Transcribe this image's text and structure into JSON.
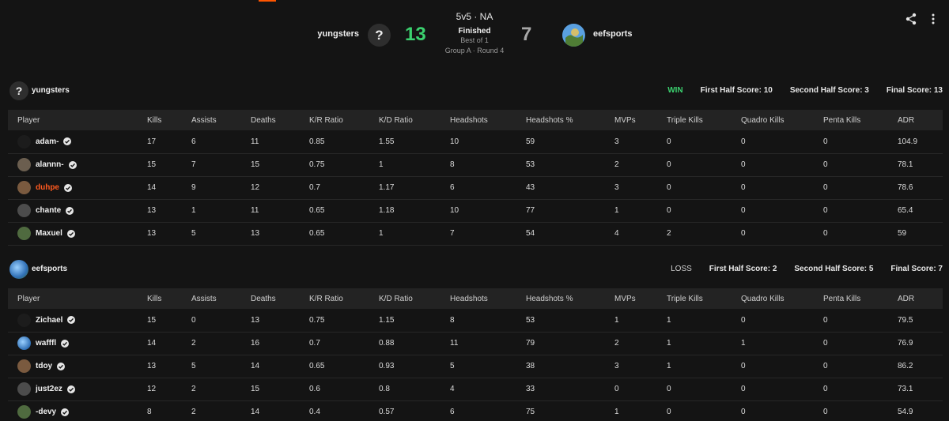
{
  "match": {
    "format": "5v5 · NA",
    "status": "Finished",
    "best_of": "Best of 1",
    "round": "Group A · Round 4"
  },
  "team1": {
    "name": "yungsters",
    "score": "13",
    "avatar_glyph": "?"
  },
  "team2": {
    "name": "eefsports",
    "score": "7"
  },
  "colors": {
    "accent": "#ff5500",
    "win": "#3bd16f",
    "highlight_player": "#ff5a1f",
    "link_blue": "#7aa7ff"
  },
  "icons": [
    "share-icon",
    "more-vertical-icon",
    "verified-check-icon",
    "question-mark-icon",
    "globe-avatar"
  ],
  "columns": [
    "Player",
    "Kills",
    "Assists",
    "Deaths",
    "K/R Ratio",
    "K/D Ratio",
    "Headshots",
    "Headshots %",
    "MVPs",
    "Triple Kills",
    "Quadro Kills",
    "Penta Kills",
    "ADR"
  ],
  "sections": [
    {
      "team": "yungsters",
      "result": "WIN",
      "first_half": "First Half Score: 10",
      "second_half": "Second Half Score: 3",
      "final": "Final Score: 13",
      "players": [
        {
          "name": "adam-",
          "stats": [
            "17",
            "6",
            "11",
            "0.85",
            "1.55",
            "10",
            "59",
            "3",
            "0",
            "0",
            "0",
            "104.9"
          ]
        },
        {
          "name": "alannn-",
          "stats": [
            "15",
            "7",
            "15",
            "0.75",
            "1",
            "8",
            "53",
            "2",
            "0",
            "0",
            "0",
            "78.1"
          ]
        },
        {
          "name": "duhpe",
          "highlight": true,
          "stats": [
            "14",
            "9",
            "12",
            "0.7",
            "1.17",
            "6",
            "43",
            "3",
            "0",
            "0",
            "0",
            "78.6"
          ]
        },
        {
          "name": "chante",
          "stats": [
            "13",
            "1",
            "11",
            "0.65",
            "1.18",
            "10",
            "77",
            "1",
            "0",
            "0",
            "0",
            "65.4"
          ]
        },
        {
          "name": "Maxuel",
          "stats": [
            "13",
            "5",
            "13",
            "0.65",
            "1",
            "7",
            "54",
            "4",
            "2",
            "0",
            "0",
            "59"
          ]
        }
      ]
    },
    {
      "team": "eefsports",
      "result": "LOSS",
      "first_half": "First Half Score: 2",
      "second_half": "Second Half Score: 5",
      "final": "Final Score: 7",
      "players": [
        {
          "name": "Zichael",
          "stats": [
            "15",
            "0",
            "13",
            "0.75",
            "1.15",
            "8",
            "53",
            "1",
            "1",
            "0",
            "0",
            "79.5"
          ]
        },
        {
          "name": "wafffl",
          "stats": [
            "14",
            "2",
            "16",
            "0.7",
            "0.88",
            "11",
            "79",
            "2",
            "1",
            "1",
            "0",
            "76.9"
          ]
        },
        {
          "name": "tdoy",
          "stats": [
            "13",
            "5",
            "14",
            "0.65",
            "0.93",
            "5",
            "38",
            "3",
            "1",
            "0",
            "0",
            "86.2"
          ]
        },
        {
          "name": "just2ez",
          "stats": [
            "12",
            "2",
            "15",
            "0.6",
            "0.8",
            "4",
            "33",
            "0",
            "0",
            "0",
            "0",
            "73.1"
          ]
        },
        {
          "name": "-devy",
          "stats": [
            "8",
            "2",
            "14",
            "0.4",
            "0.57",
            "6",
            "75",
            "1",
            "0",
            "0",
            "0",
            "54.9"
          ]
        }
      ]
    }
  ]
}
